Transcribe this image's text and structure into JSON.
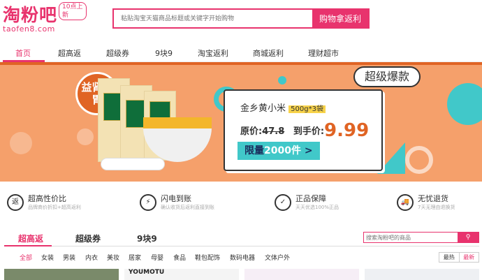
{
  "logo": {
    "text": "淘粉吧",
    "domain": "taofen8.com",
    "tag": "10点上新"
  },
  "search": {
    "placeholder": "粘贴淘宝天猫商品标题或关键字开始购物",
    "button": "购物拿返利"
  },
  "nav": {
    "items": [
      "首页",
      "超高返",
      "超级券",
      "9块9",
      "淘宝返利",
      "商城返利",
      "理财超市"
    ]
  },
  "banner": {
    "badge": "益肾养胃",
    "hot_label": "超级爆款",
    "product_name": "金乡黄小米",
    "spec": "500g*3袋",
    "original_label": "原价:",
    "original_price": "47.8",
    "final_label": "到手价:",
    "final_price": "9.99",
    "limit_prefix": "限量",
    "limit_qty": "2000件",
    "limit_arrow": ">"
  },
  "features": [
    {
      "icon": "返",
      "title": "超高性价比",
      "subtitle": "品牌商价折扣+超高返利"
    },
    {
      "icon": "⚡",
      "title": "闪电到账",
      "subtitle": "确认收货后返利直接到账"
    },
    {
      "icon": "✓",
      "title": "正品保障",
      "subtitle": "天天优选100%正品"
    },
    {
      "icon": "🚚",
      "title": "无忧退货",
      "subtitle": "7天无理由退换货"
    }
  ],
  "tabs": [
    "超高返",
    "超级券",
    "9块9"
  ],
  "search2": {
    "placeholder": "搜索淘粉吧的商品",
    "button": ""
  },
  "categories": [
    "全部",
    "女装",
    "男装",
    "内衣",
    "美妆",
    "居家",
    "母婴",
    "食品",
    "鞋包配饰",
    "数码电器",
    "文体户外"
  ],
  "sort": [
    "最热",
    "最新"
  ],
  "strip": {
    "brand": "YOUMOTU"
  },
  "colors": {
    "brand": "#e8336d",
    "banner": "#f5a06b",
    "accent": "#e06424",
    "teal": "#41c8c9"
  }
}
